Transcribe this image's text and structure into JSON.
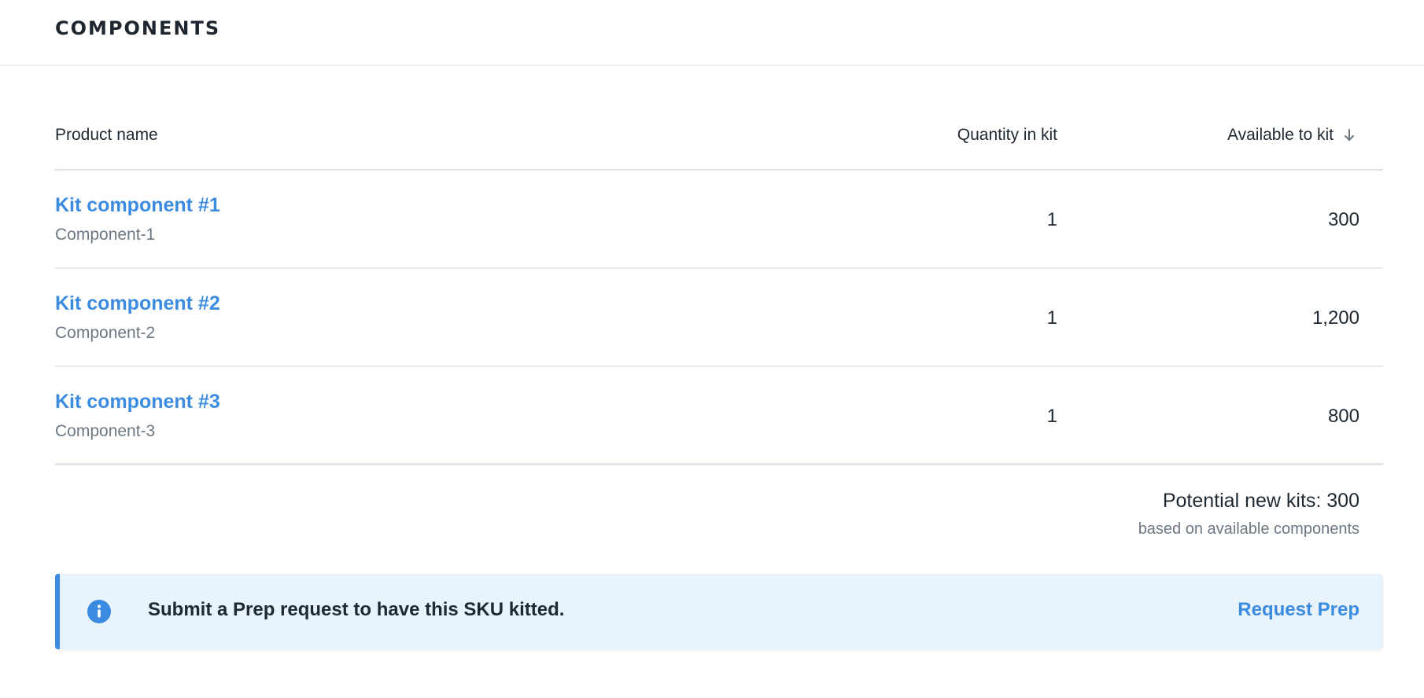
{
  "header": {
    "title": "COMPONENTS"
  },
  "table": {
    "columns": {
      "product_name": "Product name",
      "quantity": "Quantity in kit",
      "available": "Available to kit",
      "sort_icon": "arrow-down-icon"
    },
    "rows": [
      {
        "name": "Kit component #1",
        "sku": "Component-1",
        "quantity": "1",
        "available": "300"
      },
      {
        "name": "Kit component #2",
        "sku": "Component-2",
        "quantity": "1",
        "available": "1,200"
      },
      {
        "name": "Kit component #3",
        "sku": "Component-3",
        "quantity": "1",
        "available": "800"
      }
    ]
  },
  "summary": {
    "main": "Potential new kits: 300",
    "sub": "based on available components"
  },
  "banner": {
    "icon": "info-icon",
    "message": "Submit a Prep request to have this SKU kitted.",
    "action": "Request Prep"
  },
  "colors": {
    "accent": "#3b8be0",
    "banner_bg": "#e8f3fc"
  }
}
